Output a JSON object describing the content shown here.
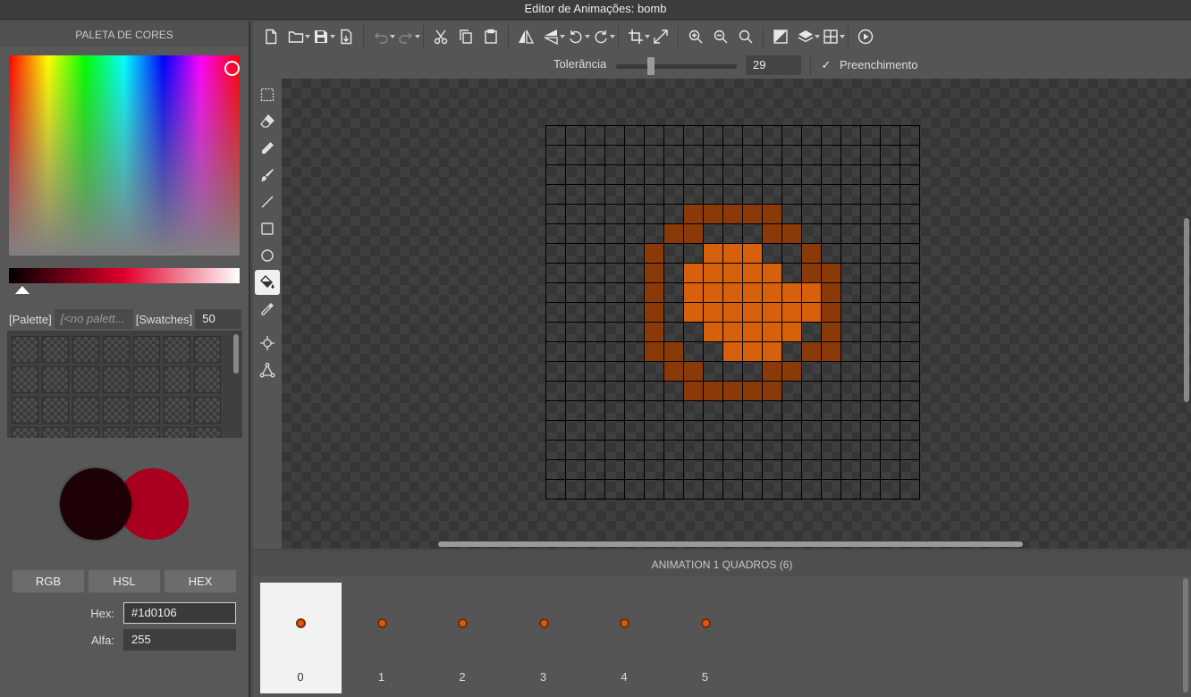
{
  "window": {
    "title": "Editor de Animações: bomb"
  },
  "palette_panel": {
    "title": "PALETA DE CORES",
    "palette_label": "[Palette]",
    "palette_value": "[<no palett...",
    "swatches_label": "[Swatches]",
    "swatches_value": "50",
    "primary_color": "#1d0106",
    "secondary_color": "#a8001e",
    "modes": [
      "RGB",
      "HSL",
      "HEX"
    ],
    "hex_label": "Hex:",
    "hex_value": "#1d0106",
    "alpha_label": "Alfa:",
    "alpha_value": "255"
  },
  "toolbar": {
    "icons": [
      "new-file-icon",
      "open-folder-icon",
      "save-icon",
      "export-icon",
      "undo-icon",
      "redo-icon",
      "cut-icon",
      "copy-icon",
      "paste-icon",
      "flip-horizontal-icon",
      "flip-vertical-icon",
      "rotate-left-icon",
      "rotate-right-icon",
      "crop-icon",
      "resize-icon",
      "zoom-in-icon",
      "zoom-out-icon",
      "zoom-reset-icon",
      "color-mode-icon",
      "layers-icon",
      "grid-icon",
      "play-icon"
    ]
  },
  "options": {
    "tolerance_label": "Tolerância",
    "tolerance_value": "29",
    "tolerance_fraction": 0.29,
    "fill_label": "Preenchimento",
    "fill_checked": true
  },
  "tools": {
    "items": [
      "select-rect-icon",
      "eraser-icon",
      "pencil-icon",
      "brush-icon",
      "line-icon",
      "rectangle-icon",
      "ellipse-icon",
      "fill-bucket-icon",
      "eyedropper-icon",
      "pivot-icon",
      "bone-icon"
    ],
    "active": "fill-bucket-icon"
  },
  "canvas": {
    "colors": {
      "dark": "#8a3a08",
      "light": "#d6600c"
    },
    "grid_size": 19,
    "pixels": [
      "...................",
      "...................",
      "...................",
      "...................",
      ".......DDDDD.......",
      "......DD...DD......",
      ".....D..LLL..D.....",
      ".....D.LLLLL.DD....",
      ".....D.LLLLLLLD....",
      ".....D.LLLLLLLD....",
      ".....D..LLLLL.D....",
      ".....DD..LLL.DD....",
      "......DD...DD......",
      ".......DDDDD.......",
      "...................",
      "...................",
      "...................",
      "...................",
      "..................."
    ]
  },
  "animation": {
    "title": "ANIMATION 1 QUADROS (6)",
    "frames": [
      "0",
      "1",
      "2",
      "3",
      "4",
      "5"
    ],
    "selected": 0
  }
}
